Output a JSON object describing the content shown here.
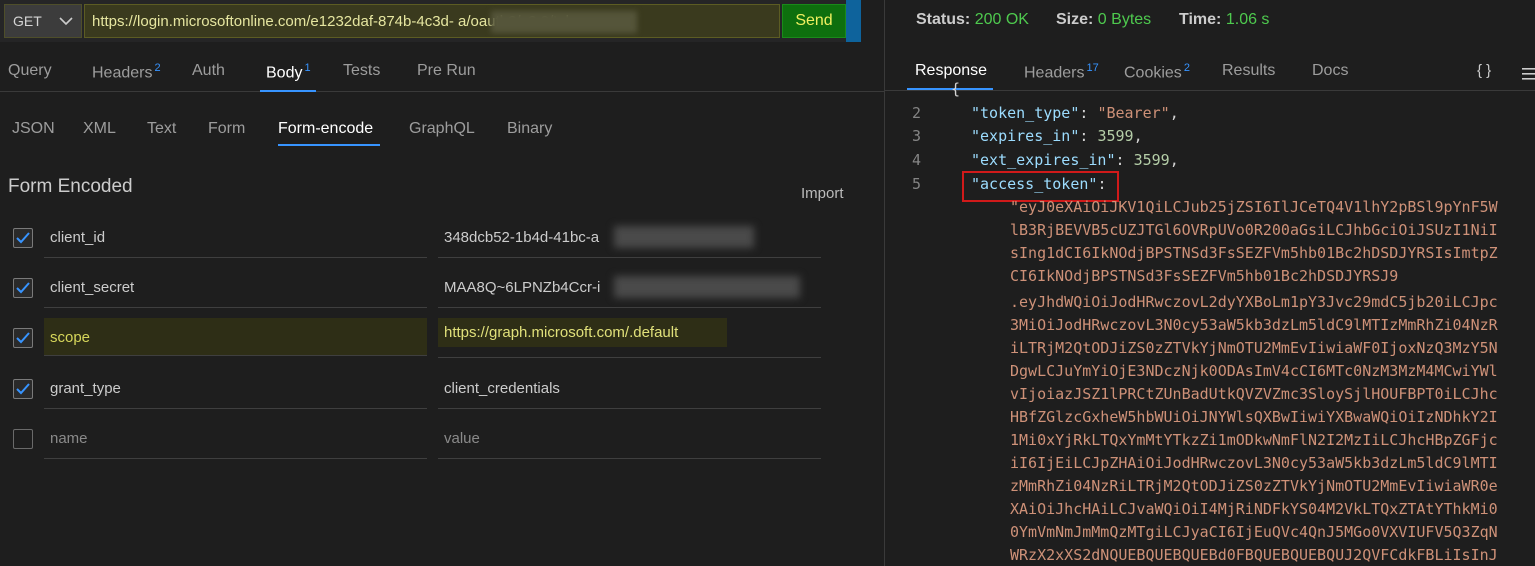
{
  "request": {
    "method": "GET",
    "url": "https://login.microsoftonline.com/e1232daf-874b-4c3d-                          a/oauth2/v2.0/token",
    "send_label": "Send"
  },
  "request_tabs": [
    {
      "label": "Query",
      "badge": ""
    },
    {
      "label": "Headers",
      "badge": "2"
    },
    {
      "label": "Auth",
      "badge": ""
    },
    {
      "label": "Body",
      "badge": "1"
    },
    {
      "label": "Tests",
      "badge": ""
    },
    {
      "label": "Pre Run",
      "badge": ""
    }
  ],
  "body_tabs": [
    "JSON",
    "XML",
    "Text",
    "Form",
    "Form-encode",
    "GraphQL",
    "Binary"
  ],
  "form": {
    "title": "Form Encoded",
    "import_label": "Import",
    "rows": [
      {
        "key": "client_id",
        "value": "348dcb52-1b4d-41bc-a",
        "checked": true
      },
      {
        "key": "client_secret",
        "value": "MAA8Q~6LPNZb4Ccr-i",
        "checked": true
      },
      {
        "key": "scope",
        "value": "https://graph.microsoft.com/.default",
        "checked": true
      },
      {
        "key": "grant_type",
        "value": "client_credentials",
        "checked": true
      },
      {
        "key": "name",
        "value": "value",
        "checked": false
      }
    ]
  },
  "response": {
    "status_label": "Status:",
    "status_value": "200 OK",
    "size_label": "Size:",
    "size_value": "0 Bytes",
    "time_label": "Time:",
    "time_value": "1.06 s",
    "tabs": [
      {
        "label": "Response",
        "badge": ""
      },
      {
        "label": "Headers",
        "badge": "17"
      },
      {
        "label": "Cookies",
        "badge": "2"
      },
      {
        "label": "Results",
        "badge": ""
      },
      {
        "label": "Docs",
        "badge": ""
      }
    ],
    "braces_label": "{ }",
    "code": {
      "line_numbers": [
        "2",
        "3",
        "4",
        "5"
      ],
      "token_type_key": "\"token_type\"",
      "token_type_value": "\"Bearer\"",
      "expires_in_key": "\"expires_in\"",
      "expires_in_value": "3599",
      "ext_expires_in_key": "\"ext_expires_in\"",
      "ext_expires_in_value": "3599",
      "access_token_key": "\"access_token\"",
      "access_token_lines": [
        "\"eyJ0eXAiOiJKV1QiLCJub25jZSI6IlJCeTQ4V1lhY2pBSl9pYnF5W",
        "lB3RjBEVVB5cUZJTGl6OVRpUVo0R200aGsiLCJhbGciOiJSUzI1NiI",
        "sIng1dCI6IkNOdjBPSTNSd3FsSEZFVm5hb01Bc2hDSDJYRSIsImtpZ",
        "CI6IkNOdjBPSTNSd3FsSEZFVm5hb01Bc2hDSDJYRSJ9",
        ".eyJhdWQiOiJodHRwczovL2dyYXBoLm1pY3Jvc29mdC5jb20iLCJpc",
        "3MiOiJodHRwczovL3N0cy53aW5kb3dzLm5ldC9lMTIzMmRhZi04NzR",
        "iLTRjM2QtODJiZS0zZTVkYjNmOTU2MmEvIiwiaWF0IjoxNzQ3MzY5N",
        "DgwLCJuYmYiOjE3NDczNjk0ODAsImV4cCI6MTc0NzM3MzM4MCwiYWl",
        "vIjoiazJSZ1lPRCtZUnBadUtkQVZVZmc3SloySjlHOUFBPT0iLCJhc",
        "HBfZGlzcGxheW5hbWUiOiJNYWlsQXBwIiwiYXBwaWQiOiIzNDhkY2I",
        "1Mi0xYjRkLTQxYmMtYTkzZi1mODkwNmFlN2I2MzIiLCJhcHBpZGFjc",
        "iI6IjEiLCJpZHAiOiJodHRwczovL3N0cy53aW5kb3dzLm5ldC9lMTI",
        "zMmRhZi04NzRiLTRjM2QtODJiZS0zZTVkYjNmOTU2MmEvIiwiaWR0e",
        "XAiOiJhcHAiLCJvaWQiOiI4MjRiNDFkYS04M2VkLTQxZTAtYThkMi0",
        "0YmVmNmJmMmQzMTgiLCJyaCI6IjEuQVc4QnJ5MGo0VXVIUFV5Q3ZqN",
        "WRzX2xXS2dNQUEBQUEBQUEBd0FBQUEBQUEBQUJ2QVFCdkFBLiIsInJ"
      ]
    }
  }
}
